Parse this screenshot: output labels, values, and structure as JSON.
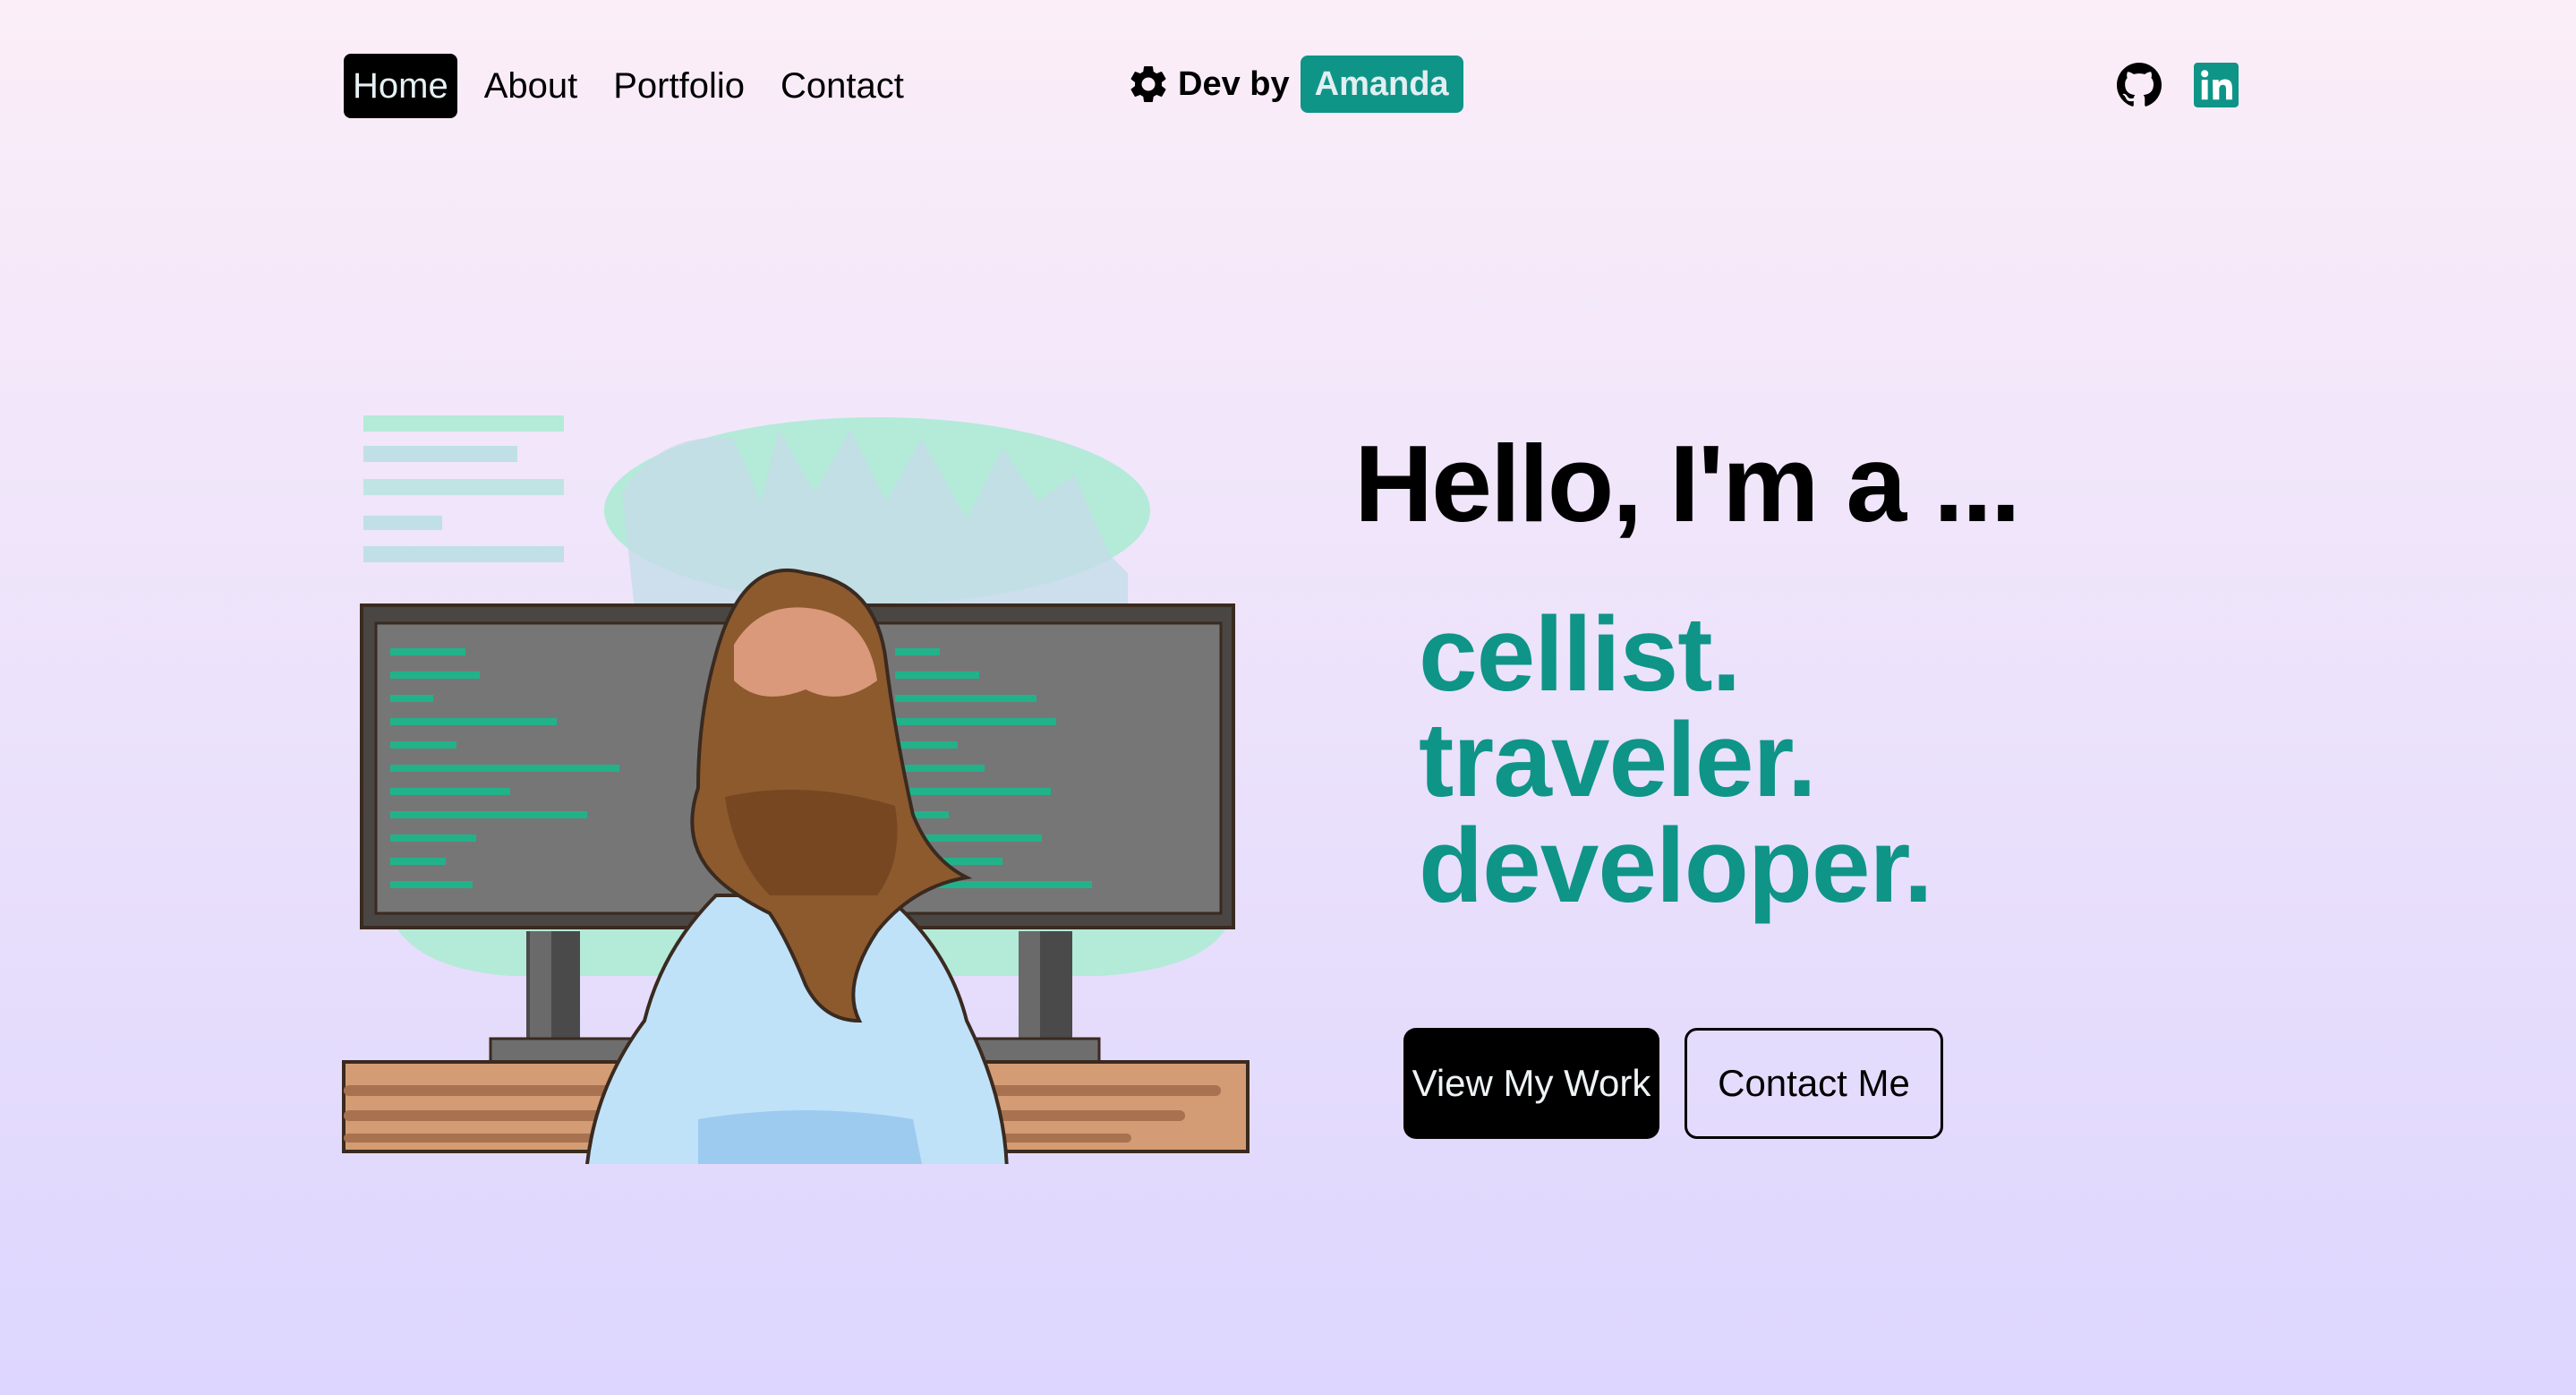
{
  "nav": {
    "links": [
      {
        "label": "Home",
        "active": true
      },
      {
        "label": "About",
        "active": false
      },
      {
        "label": "Portfolio",
        "active": false
      },
      {
        "label": "Contact",
        "active": false
      }
    ],
    "brand": {
      "prefix": "Dev by",
      "name": "Amanda",
      "icon": "gear-icon"
    },
    "social": [
      {
        "name": "GitHub",
        "icon": "github-icon"
      },
      {
        "name": "LinkedIn",
        "icon": "linkedin-icon"
      }
    ]
  },
  "hero": {
    "headline": "Hello, I'm a ...",
    "roles": [
      "cellist.",
      "traveler.",
      "developer."
    ],
    "buttons": {
      "primary": "View My Work",
      "secondary": "Contact Me"
    },
    "illustration": "woman-coding-at-dual-monitors"
  },
  "colors": {
    "accent": "#0f9488",
    "bg_top": "#fbeef8",
    "bg_bottom": "#ddd6fe",
    "text": "#000000"
  }
}
